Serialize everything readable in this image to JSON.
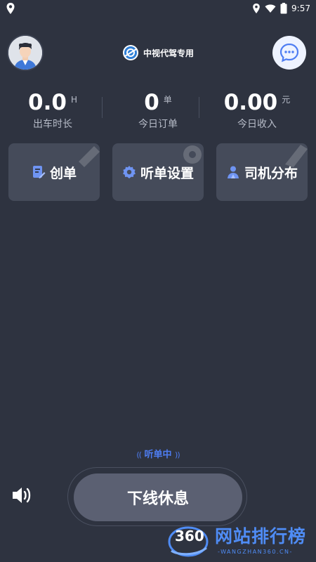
{
  "status_bar": {
    "time": "9:57"
  },
  "header": {
    "title": "中视代驾专用"
  },
  "stats": [
    {
      "value": "0.0",
      "unit": "H",
      "label": "出车时长"
    },
    {
      "value": "0",
      "unit": "单",
      "label": "今日订单"
    },
    {
      "value": "0.00",
      "unit": "元",
      "label": "今日收入"
    }
  ],
  "actions": [
    {
      "label": "创单",
      "icon": "create-order-icon"
    },
    {
      "label": "听单设置",
      "icon": "gear-icon"
    },
    {
      "label": "司机分布",
      "icon": "driver-icon"
    }
  ],
  "listening": {
    "text": "听单中"
  },
  "bottom": {
    "off_button": "下线休息"
  },
  "watermark": {
    "number": "360",
    "text": "网站排行榜",
    "sub": "-WANGZHAN360.CN-"
  },
  "colors": {
    "background": "#2e3340",
    "card": "#454b5a",
    "accent": "#4e7df2",
    "button": "#5b6072"
  }
}
